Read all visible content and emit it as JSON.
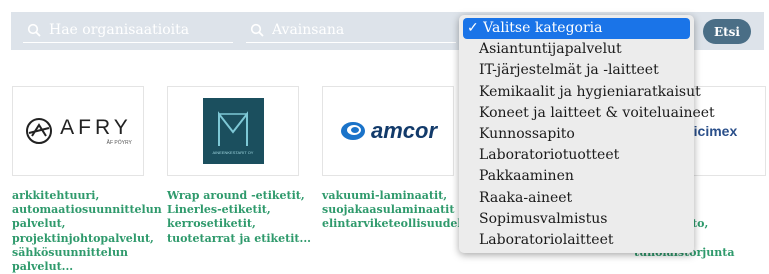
{
  "search": {
    "org_placeholder": "Hae organisaatioita",
    "keyword_placeholder": "Avainsana",
    "submit_label": "Etsi",
    "icon": "search-icon"
  },
  "category_select": {
    "selected_label": "✓ Valitse kategoria",
    "options": [
      "Asiantuntijapalvelut",
      "IT-järjestelmät ja -laitteet",
      "Kemikaalit ja hygieniaratkaisut",
      "Koneet ja laitteet & voiteluaineet",
      "Kunnossapito",
      "Laboratoriotuotteet",
      "Pakkaaminen",
      "Raaka-aineet",
      "Sopimusvalmistus",
      "Laboratoriolaitteet"
    ]
  },
  "companies": [
    {
      "logo_text": "AFRY",
      "logo_subtext": "ÅF PÖYRY",
      "description": "arkkitehtuuri, automaatiosuunnittelun palvelut, projektinjohtopalvelut, sähkösuunnittelun palvelut..."
    },
    {
      "logo_subtext": "AINEENKESTARIT OY",
      "description": "Wrap around -etiketit, Linerles-etiketit, kerrosetiketit, tuotetarrat ja etiketit..."
    },
    {
      "logo_text": "amcor",
      "description": "vakuumi-laminaatit, suojakaasulaminaatit elintarviketeollisuudelle"
    },
    {
      "logo_text": "ticimex",
      "description": "-palvelut,\nus- ja\näytteenotto,\nsitestit,\ntuholaistorjunta"
    }
  ],
  "colors": {
    "bar_bg": "#dde3ea",
    "button_bg": "#4a6e86",
    "link_green": "#2f9a6c",
    "select_highlight": "#1a74e8",
    "mark_teal": "#1b4f5e"
  }
}
